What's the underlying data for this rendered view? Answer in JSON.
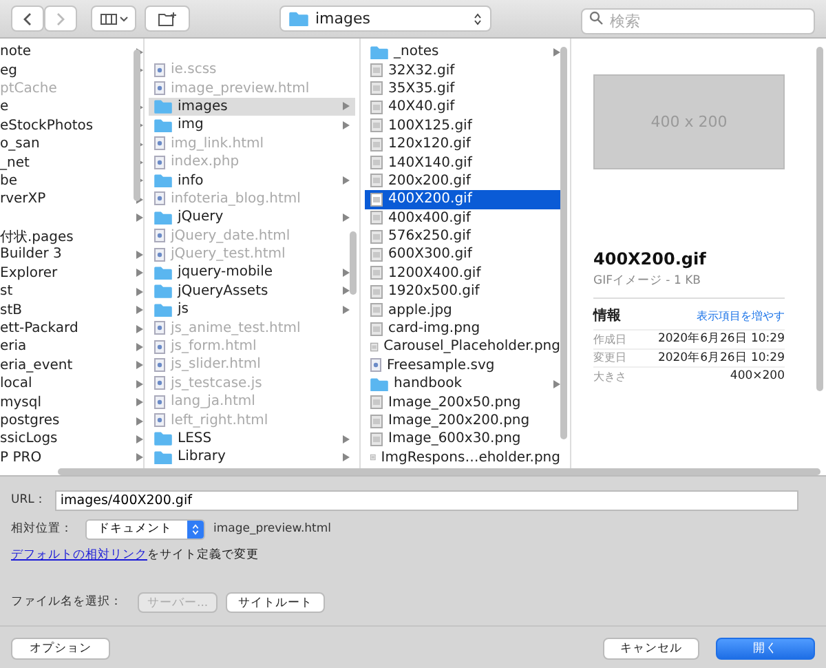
{
  "toolbar": {
    "back": {
      "disabled": false
    },
    "forward": {
      "disabled": true
    },
    "path": "images",
    "search": {
      "placeholder": "検索"
    }
  },
  "columns": [
    {
      "items": [
        {
          "label": "note",
          "kind": "folder",
          "disabled": false,
          "selected": false
        },
        {
          "label": "eg",
          "kind": "folder",
          "disabled": false,
          "selected": false
        },
        {
          "label": "ptCache",
          "kind": "file",
          "disabled": true,
          "selected": false
        },
        {
          "label": "e",
          "kind": "folder",
          "disabled": false,
          "selected": false
        },
        {
          "label": "eStockPhotos",
          "kind": "folder",
          "disabled": false,
          "selected": false
        },
        {
          "label": "o_san",
          "kind": "folder",
          "disabled": false,
          "selected": false
        },
        {
          "label": "_net",
          "kind": "folder",
          "disabled": false,
          "selected": false
        },
        {
          "label": "be",
          "kind": "folder",
          "disabled": false,
          "selected": false
        },
        {
          "label": "rverXP",
          "kind": "folder",
          "disabled": false,
          "selected": false
        },
        {
          "kind": "folder",
          "disabled": false,
          "selected": false
        },
        {
          "label": "付状.pages",
          "kind": "file",
          "disabled": false,
          "selected": false
        },
        {
          "label": "Builder 3",
          "kind": "folder",
          "disabled": false,
          "selected": false
        },
        {
          "label": "Explorer",
          "kind": "folder",
          "disabled": false,
          "selected": false
        },
        {
          "label": "st",
          "kind": "folder",
          "disabled": false,
          "selected": false
        },
        {
          "label": "stB",
          "kind": "folder",
          "disabled": false,
          "selected": false
        },
        {
          "label": "ett-Packard",
          "kind": "folder",
          "disabled": false,
          "selected": false
        },
        {
          "label": "eria",
          "kind": "folder",
          "disabled": false,
          "selected": false
        },
        {
          "label": "eria_event",
          "kind": "folder",
          "disabled": false,
          "selected": false
        },
        {
          "label": "local",
          "kind": "folder",
          "disabled": false,
          "selected": false
        },
        {
          "label": "mysql",
          "kind": "folder",
          "disabled": false,
          "selected": false
        },
        {
          "label": "postgres",
          "kind": "folder",
          "disabled": false,
          "selected": false
        },
        {
          "label": "ssicLogs",
          "kind": "folder",
          "disabled": false,
          "selected": false
        },
        {
          "label": "P PRO",
          "kind": "folder",
          "disabled": false,
          "selected": false
        }
      ]
    },
    {
      "items": [
        {
          "label": "ie.scss",
          "kind": "file",
          "disabled": true,
          "selected": false
        },
        {
          "label": "image_preview.html",
          "kind": "file",
          "disabled": true,
          "selected": false
        },
        {
          "label": "images",
          "kind": "folder",
          "disabled": false,
          "selected": true
        },
        {
          "label": "img",
          "kind": "folder",
          "disabled": false,
          "selected": false
        },
        {
          "label": "img_link.html",
          "kind": "file",
          "disabled": true,
          "selected": false
        },
        {
          "label": "index.php",
          "kind": "file",
          "disabled": true,
          "selected": false
        },
        {
          "label": "info",
          "kind": "folder",
          "disabled": false,
          "selected": false
        },
        {
          "label": "infoteria_blog.html",
          "kind": "file",
          "disabled": true,
          "selected": false
        },
        {
          "label": "jQuery",
          "kind": "folder",
          "disabled": false,
          "selected": false
        },
        {
          "label": "jQuery_date.html",
          "kind": "file",
          "disabled": true,
          "selected": false
        },
        {
          "label": "jQuery_test.html",
          "kind": "file",
          "disabled": true,
          "selected": false
        },
        {
          "label": "jquery-mobile",
          "kind": "folder",
          "disabled": false,
          "selected": false
        },
        {
          "label": "jQueryAssets",
          "kind": "folder",
          "disabled": false,
          "selected": false
        },
        {
          "label": "js",
          "kind": "folder",
          "disabled": false,
          "selected": false
        },
        {
          "label": "js_anime_test.html",
          "kind": "file",
          "disabled": true,
          "selected": false
        },
        {
          "label": "js_form.html",
          "kind": "file",
          "disabled": true,
          "selected": false
        },
        {
          "label": "js_slider.html",
          "kind": "file",
          "disabled": true,
          "selected": false
        },
        {
          "label": "js_testcase.js",
          "kind": "file",
          "disabled": true,
          "selected": false
        },
        {
          "label": "lang_ja.html",
          "kind": "file",
          "disabled": true,
          "selected": false
        },
        {
          "label": "left_right.html",
          "kind": "file",
          "disabled": true,
          "selected": false
        },
        {
          "label": "LESS",
          "kind": "folder",
          "disabled": false,
          "selected": false
        },
        {
          "label": "Library",
          "kind": "folder",
          "disabled": false,
          "selected": false
        }
      ]
    },
    {
      "items": [
        {
          "label": "_notes",
          "kind": "folder",
          "disabled": false,
          "selected": false
        },
        {
          "label": "32X32.gif",
          "kind": "image",
          "disabled": false,
          "selected": false
        },
        {
          "label": "35X35.gif",
          "kind": "image",
          "disabled": false,
          "selected": false
        },
        {
          "label": "40X40.gif",
          "kind": "image",
          "disabled": false,
          "selected": false
        },
        {
          "label": "100X125.gif",
          "kind": "image",
          "disabled": false,
          "selected": false
        },
        {
          "label": "120x120.gif",
          "kind": "image",
          "disabled": false,
          "selected": false
        },
        {
          "label": "140X140.gif",
          "kind": "image",
          "disabled": false,
          "selected": false
        },
        {
          "label": "200x200.gif",
          "kind": "image",
          "disabled": false,
          "selected": false
        },
        {
          "label": "400X200.gif",
          "kind": "image",
          "disabled": false,
          "selected": true
        },
        {
          "label": "400x400.gif",
          "kind": "image",
          "disabled": false,
          "selected": false
        },
        {
          "label": "576x250.gif",
          "kind": "image",
          "disabled": false,
          "selected": false
        },
        {
          "label": "600X300.gif",
          "kind": "image",
          "disabled": false,
          "selected": false
        },
        {
          "label": "1200X400.gif",
          "kind": "image",
          "disabled": false,
          "selected": false
        },
        {
          "label": "1920x500.gif",
          "kind": "image",
          "disabled": false,
          "selected": false
        },
        {
          "label": "apple.jpg",
          "kind": "image",
          "disabled": false,
          "selected": false
        },
        {
          "label": "card-img.png",
          "kind": "image",
          "disabled": false,
          "selected": false
        },
        {
          "label": "Carousel_Placeholder.png",
          "kind": "image",
          "disabled": false,
          "selected": false
        },
        {
          "label": "Freesample.svg",
          "kind": "file",
          "disabled": false,
          "selected": false
        },
        {
          "label": "handbook",
          "kind": "folder",
          "disabled": false,
          "selected": false
        },
        {
          "label": "Image_200x50.png",
          "kind": "image",
          "disabled": false,
          "selected": false
        },
        {
          "label": "Image_200x200.png",
          "kind": "image",
          "disabled": false,
          "selected": false
        },
        {
          "label": "Image_600x30.png",
          "kind": "image",
          "disabled": false,
          "selected": false
        },
        {
          "label": "ImgRespons…eholder.png",
          "kind": "image",
          "disabled": false,
          "selected": false
        }
      ]
    }
  ],
  "preview": {
    "image_text": "400 x 200",
    "name": "400X200.gif",
    "subtitle": "GIFイメージ - 1 KB",
    "info_heading": "情報",
    "more_link": "表示項目を増やす",
    "info": [
      {
        "label": "作成日",
        "value": "2020年6月26日 10:29"
      },
      {
        "label": "変更日",
        "value": "2020年6月26日 10:29"
      },
      {
        "label": "大きさ",
        "value": "400×200"
      }
    ]
  },
  "url": {
    "label": "URL：",
    "value": "images/400X200.gif"
  },
  "relative": {
    "label": "相対位置：",
    "value": "ドキュメント",
    "file": "image_preview.html"
  },
  "relative_note": {
    "link": "デフォルトの相対リンク",
    "text": "をサイト定義で変更"
  },
  "file_select": {
    "label": "ファイル名を選択：",
    "buttons": [
      {
        "label": "サーバー...",
        "disabled": true
      },
      {
        "label": "サイトルート",
        "disabled": false
      }
    ]
  },
  "footer": {
    "options": "オプション",
    "cancel": "キャンセル",
    "open": "開く"
  }
}
